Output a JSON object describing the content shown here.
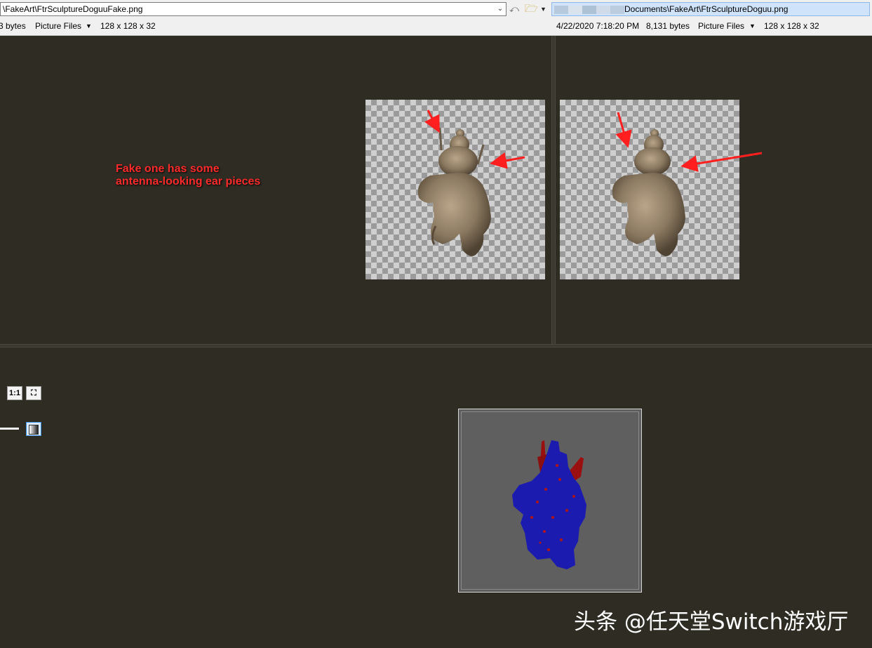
{
  "left_panel": {
    "path": "\\FakeArt\\FtrSculptureDoguuFake.png",
    "status": {
      "size": "3 bytes",
      "filter": "Picture Files",
      "dims": "128 x 128 x 32"
    }
  },
  "right_panel": {
    "path": "Documents\\FakeArt\\FtrSculptureDoguu.png",
    "status": {
      "date": "4/22/2020 7:18:20 PM",
      "size": "8,131 bytes",
      "filter": "Picture Files",
      "dims": "128 x 128 x 32"
    }
  },
  "annotation": {
    "line1": "Fake one has some",
    "line2": "antenna-looking ear pieces"
  },
  "controls": {
    "actual_size_label": "1:1"
  },
  "watermark": "头条 @任天堂Switch游戏厅",
  "colors": {
    "annotation": "#ff2b2b",
    "background": "#2e2c23",
    "diff_blue": "#1b1bb0",
    "diff_red": "#9a1010"
  },
  "icons": [
    "chevron-down-icon",
    "back-arrow-icon",
    "folder-icon",
    "fit-to-window-icon",
    "gradient-icon"
  ]
}
